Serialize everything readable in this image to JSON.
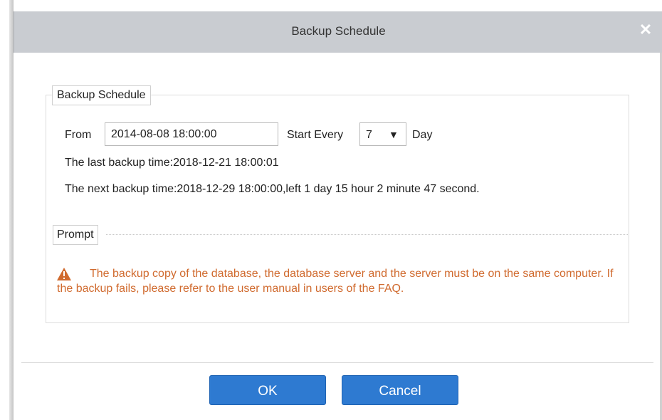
{
  "dialog": {
    "title": "Backup Schedule",
    "close_symbol": "✕"
  },
  "schedule": {
    "legend": "Backup Schedule",
    "from_label": "From",
    "from_value": "2014-08-08 18:00:00",
    "start_every_label": "Start Every",
    "interval_value": "7",
    "interval_options": [
      "7"
    ],
    "day_label": "Day",
    "last_backup": "The last backup time:2018-12-21 18:00:01",
    "next_backup": "The next backup time:2018-12-29 18:00:00,left 1 day 15 hour 2 minute 47 second."
  },
  "prompt": {
    "legend": "Prompt",
    "icon": "warning-icon",
    "message": "The backup copy of the database, the database server and the server must be on the same computer. If the backup fails, please refer to the user manual in users of the FAQ."
  },
  "buttons": {
    "ok": "OK",
    "cancel": "Cancel"
  },
  "colors": {
    "accent": "#2e7ad1",
    "warning": "#d06a2e",
    "titlebar": "#c9ccd1"
  }
}
